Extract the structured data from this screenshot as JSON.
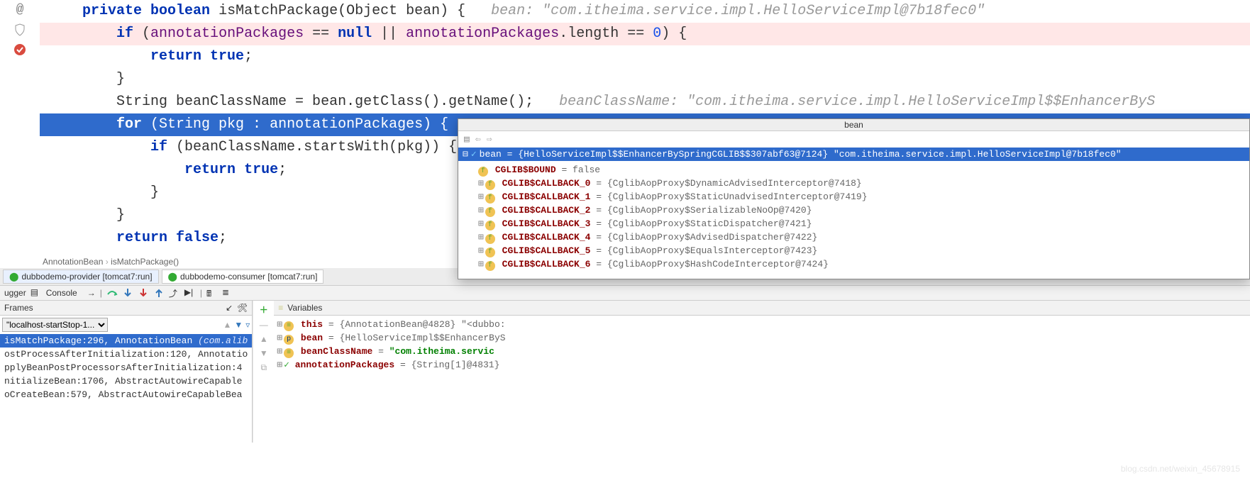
{
  "code": {
    "line1_kw_private": "private",
    "line1_kw_boolean": "boolean",
    "line1_name": "isMatchPackage",
    "line1_param": "Object bean",
    "line1_comment": "bean: \"com.itheima.service.impl.HelloServiceImpl@7b18fec0\"",
    "line2_if": "if",
    "line2_ap": "annotationPackages",
    "line2_eq": " == ",
    "line2_null": "null",
    "line2_or": " || ",
    "line2_ap2": "annotationPackages",
    "line2_len": ".length == ",
    "line2_zero": "0",
    "line2_end": ") {",
    "line3_return": "return",
    "line3_true": "true",
    "line3_semi": ";",
    "line4": "}",
    "line5_pre": "String beanClassName = bean.getClass().getName();",
    "line5_cm": "beanClassName: \"com.itheima.service.impl.HelloServiceImpl$$EnhancerByS",
    "line6_for": "for",
    "line6_body": " (String pkg : ",
    "line6_ap": "annotationPackages",
    "line6_end": ") {",
    "line7_if": "if",
    "line7_body": " (beanClassName.startsWith(pkg)) {",
    "line8_return": "return",
    "line8_true": "true",
    "line8_semi": ";",
    "line9": "}",
    "line10": "}",
    "line11_pre": "return ",
    "line11_false": "false",
    "line11_semi": ";"
  },
  "crumbs": {
    "a": "AnnotationBean",
    "sep": "›",
    "b": "isMatchPackage()"
  },
  "runTabs": [
    {
      "label": "dubbodemo-provider [tomcat7:run]"
    },
    {
      "label": "dubbodemo-consumer [tomcat7:run]"
    }
  ],
  "toolbar": {
    "ugger": "ugger",
    "console": "Console"
  },
  "frames": {
    "title": "Frames",
    "thread": "\"localhost-startStop-1...",
    "rows": [
      {
        "txt": "isMatchPackage:296, AnnotationBean ",
        "ital": "(com.alib"
      },
      {
        "txt": "ostProcessAfterInitialization:120, Annotatio"
      },
      {
        "txt": "pplyBeanPostProcessorsAfterInitialization:4"
      },
      {
        "txt": "nitializeBean:1706, AbstractAutowireCapable"
      },
      {
        "txt": "oCreateBean:579, AbstractAutowireCapableBea"
      }
    ]
  },
  "vars": {
    "title": "Variables",
    "rows": [
      {
        "ic": "≡",
        "name": "this",
        "eq": " = ",
        "val": "{AnnotationBean@4828} \"<dubbo:"
      },
      {
        "ic": "p",
        "name": "bean",
        "eq": " = ",
        "val": "{HelloServiceImpl$$EnhancerByS"
      },
      {
        "ic": "≡",
        "name": "beanClassName",
        "eq": " = ",
        "val": "\"com.itheima.servic",
        "str": true
      },
      {
        "ic": "✓",
        "name": "annotationPackages",
        "eq": " = ",
        "val": "{String[1]@4831}"
      }
    ]
  },
  "popup": {
    "title": "bean",
    "root": "bean = {HelloServiceImpl$$EnhancerBySpringCGLIB$$307abf63@7124} \"com.itheima.service.impl.HelloServiceImpl@7b18fec0\"",
    "rows": [
      {
        "name": "CGLIB$BOUND",
        "val": " = false"
      },
      {
        "name": "CGLIB$CALLBACK_0",
        "val": " = {CglibAopProxy$DynamicAdvisedInterceptor@7418}"
      },
      {
        "name": "CGLIB$CALLBACK_1",
        "val": " = {CglibAopProxy$StaticUnadvisedInterceptor@7419}"
      },
      {
        "name": "CGLIB$CALLBACK_2",
        "val": " = {CglibAopProxy$SerializableNoOp@7420}"
      },
      {
        "name": "CGLIB$CALLBACK_3",
        "val": " = {CglibAopProxy$StaticDispatcher@7421}"
      },
      {
        "name": "CGLIB$CALLBACK_4",
        "val": " = {CglibAopProxy$AdvisedDispatcher@7422}"
      },
      {
        "name": "CGLIB$CALLBACK_5",
        "val": " = {CglibAopProxy$EqualsInterceptor@7423}"
      },
      {
        "name": "CGLIB$CALLBACK_6",
        "val": " = {CglibAopProxy$HashCodeInterceptor@7424}"
      }
    ]
  },
  "watermark": "blog.csdn.net/weixin_45678915"
}
